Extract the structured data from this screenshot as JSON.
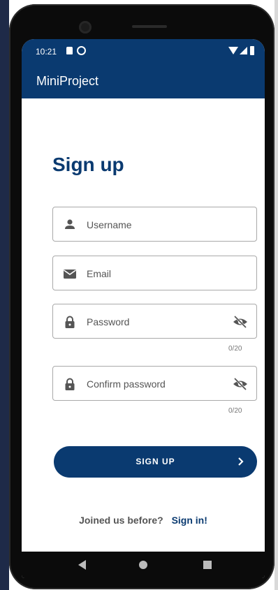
{
  "status_bar": {
    "time": "10:21"
  },
  "app_bar": {
    "title": "MiniProject"
  },
  "form": {
    "heading": "Sign up",
    "username": {
      "placeholder": "Username",
      "icon": "person-icon"
    },
    "email": {
      "placeholder": "Email",
      "icon": "mail-icon"
    },
    "password": {
      "placeholder": "Password",
      "icon": "lock-icon",
      "counter": "0/20"
    },
    "confirm_password": {
      "placeholder": "Confirm password",
      "icon": "lock-icon",
      "counter": "0/20"
    },
    "signup_button": "SIGN UP",
    "footer_question": "Joined us before?",
    "signin_link": "Sign in!"
  },
  "colors": {
    "primary": "#0a3a70",
    "background": "#ffffff"
  }
}
